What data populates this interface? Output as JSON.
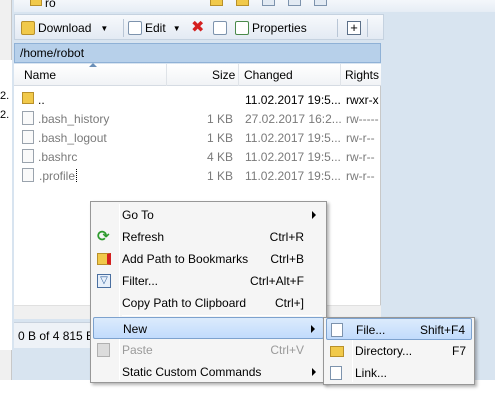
{
  "left_pane": {
    "fragments": [
      "2.",
      "2."
    ]
  },
  "toolbar": {
    "top_label": "ro",
    "download_label": "Download",
    "edit_label": "Edit",
    "properties_label": "Properties"
  },
  "path": "/home/robot",
  "columns": {
    "name": "Name",
    "size": "Size",
    "changed": "Changed",
    "rights": "Rights"
  },
  "files": [
    {
      "name": "..",
      "size": "",
      "changed": "11.02.2017 19:5...",
      "rights": "rwxr-x",
      "icon": "folder-up-icon"
    },
    {
      "name": ".bash_history",
      "size": "1 KB",
      "changed": "27.02.2017 16:2...",
      "rights": "rw-----",
      "icon": "file-icon"
    },
    {
      "name": ".bash_logout",
      "size": "1 KB",
      "changed": "11.02.2017 19:5...",
      "rights": "rw-r--",
      "icon": "file-icon"
    },
    {
      "name": ".bashrc",
      "size": "4 KB",
      "changed": "11.02.2017 19:5...",
      "rights": "rw-r--",
      "icon": "file-icon"
    },
    {
      "name": ".profile",
      "size": "1 KB",
      "changed": "11.02.2017 19:5...",
      "rights": "rw-r--",
      "icon": "file-icon"
    }
  ],
  "status": {
    "text": "0 B of 4 815 B"
  },
  "context_menu": {
    "go_to": {
      "label": "Go To"
    },
    "refresh": {
      "label": "Refresh",
      "shortcut": "Ctrl+R"
    },
    "add_bookmark": {
      "label": "Add Path to Bookmarks",
      "shortcut": "Ctrl+B"
    },
    "filter": {
      "label": "Filter...",
      "shortcut": "Ctrl+Alt+F"
    },
    "copy_path": {
      "label": "Copy Path to Clipboard",
      "shortcut": "Ctrl+]"
    },
    "new": {
      "label": "New"
    },
    "paste": {
      "label": "Paste",
      "shortcut": "Ctrl+V"
    },
    "static_commands": {
      "label": "Static Custom Commands"
    }
  },
  "submenu_new": {
    "file": {
      "label": "File...",
      "shortcut": "Shift+F4"
    },
    "directory": {
      "label": "Directory...",
      "shortcut": "F7"
    },
    "link": {
      "label": "Link..."
    }
  },
  "colors": {
    "accent": "#c1dbfc",
    "path_bar": "#b7d0ea",
    "delete_red": "#d42020",
    "refresh_green": "#2e9b2e"
  }
}
